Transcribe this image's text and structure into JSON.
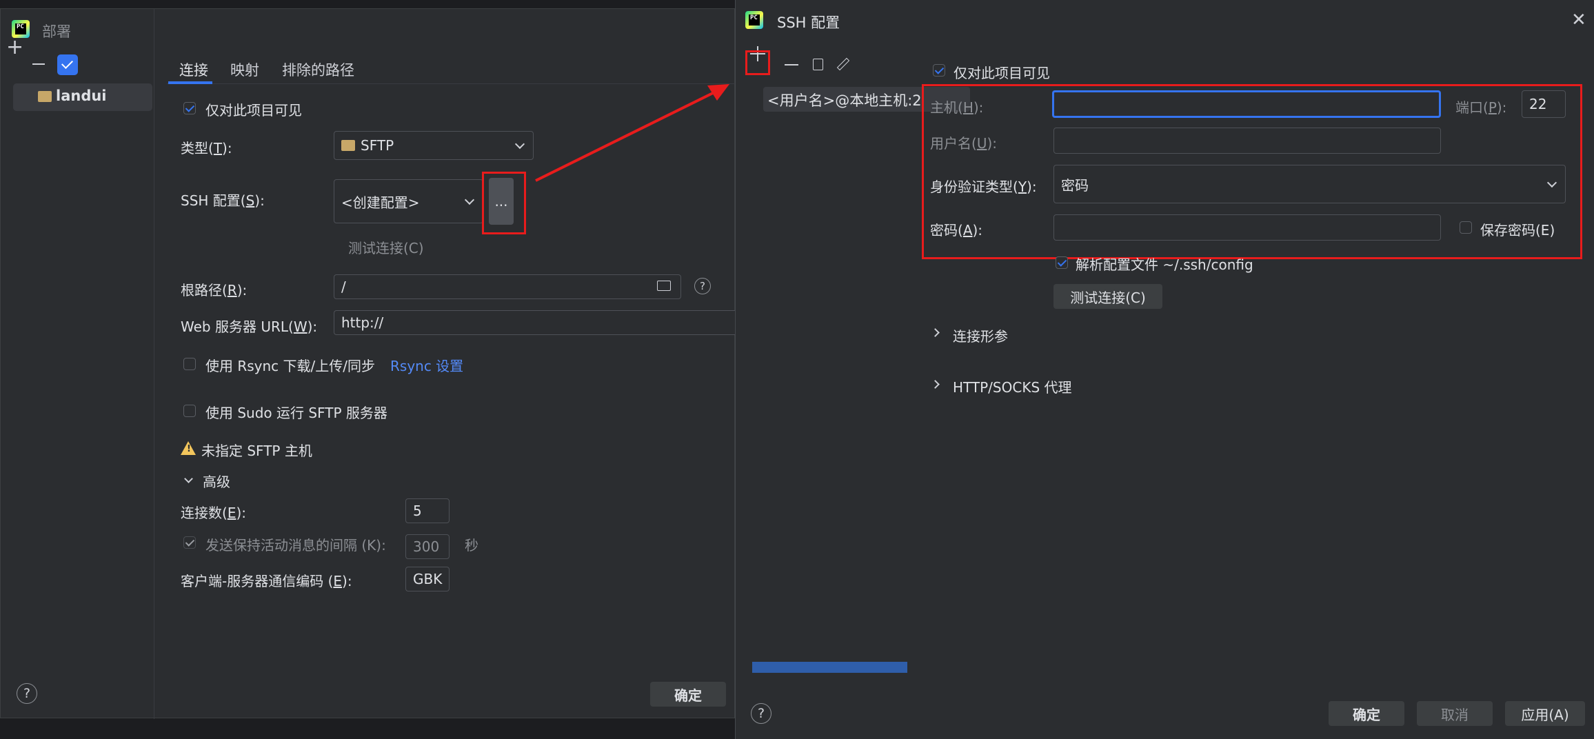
{
  "left": {
    "title": "部署",
    "server_name": "landui",
    "tabs": [
      "连接",
      "映射",
      "排除的路径"
    ],
    "visible_only": "仅对此项目可见",
    "type_label": "类型(T):",
    "type_value": "SFTP",
    "ssh_label": "SSH 配置(S):",
    "ssh_value": "<创建配置>",
    "ellipsis": "...",
    "test_conn": "测试连接(C)",
    "root_label": "根路径(R):",
    "root_value": "/",
    "web_label": "Web 服务器 URL(W):",
    "web_value": "http://",
    "rsync_label": "使用 Rsync 下载/上传/同步",
    "rsync_link": "Rsync 设置",
    "sudo_label": "使用 Sudo 运行 SFTP 服务器",
    "warning": "未指定 SFTP 主机",
    "advanced": "高级",
    "conn_count_label": "连接数(E):",
    "conn_count_value": "5",
    "keepalive_label": "发送保持活动消息的间隔 (K):",
    "keepalive_value": "300",
    "keepalive_unit": "秒",
    "encoding_label": "客户端-服务器通信编码 (E):",
    "encoding_value": "GBK",
    "ok": "确定",
    "help": "?"
  },
  "right": {
    "title": "SSH 配置",
    "config_item": "<用户名>@本地主机:2",
    "visible_only": "仅对此项目可见",
    "host_label": "主机(H):",
    "host_value": "",
    "port_label": "端口(P):",
    "port_value": "22",
    "user_label": "用户名(U):",
    "user_value": "",
    "auth_label": "身份验证类型(Y):",
    "auth_value": "密码",
    "pwd_label": "密码(A):",
    "pwd_value": "",
    "save_pwd": "保存密码(E)",
    "parse_config": "解析配置文件 ~/.ssh/config",
    "test_conn": "测试连接(C)",
    "conn_params": "连接形参",
    "proxy": "HTTP/SOCKS 代理",
    "ok": "确定",
    "cancel": "取消",
    "apply": "应用(A)",
    "help": "?"
  },
  "colors": {
    "accent": "#3574f0",
    "annotation": "#e81c1c",
    "link": "#548af7",
    "warning": "#f2c55c"
  }
}
